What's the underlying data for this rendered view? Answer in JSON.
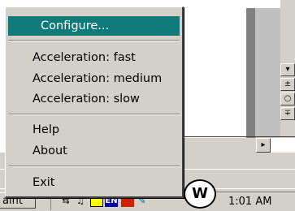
{
  "menu": {
    "items": [
      {
        "label": "Configure...",
        "highlighted": true
      },
      {
        "label": "Acceleration: fast"
      },
      {
        "label": "Acceleration: medium"
      },
      {
        "label": "Acceleration: slow"
      },
      {
        "label": "Help"
      },
      {
        "label": "About"
      },
      {
        "label": "Exit"
      }
    ]
  },
  "taskbar": {
    "task_label": "aint",
    "tray_en": "EN",
    "clock": "1:01 AM"
  },
  "background": {
    "scroll_up": "▾",
    "scroll_mid": "±",
    "scroll_circle": "○",
    "scroll_down": "∓",
    "hscroll_right": "▸"
  },
  "colors": {
    "menu_highlight": "#0f7a78",
    "window_gray": "#d4d0c8"
  }
}
